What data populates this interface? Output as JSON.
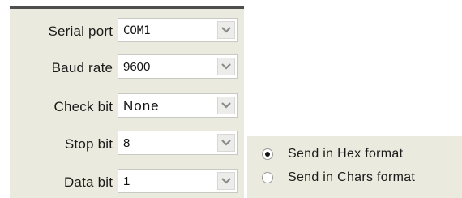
{
  "settings": {
    "rows": [
      {
        "label": "Serial port :",
        "value": "COM1"
      },
      {
        "label": "Baud rate :",
        "value": "9600"
      },
      {
        "label": "Check bit :",
        "value": "None"
      },
      {
        "label": "Stop bit :",
        "value": "8"
      },
      {
        "label": "Data bit :",
        "value": "1"
      }
    ],
    "dropdown_icon": "chevron-down-icon"
  },
  "send_format": {
    "options": [
      {
        "label": "Send in Hex format",
        "selected": true
      },
      {
        "label": "Send in Chars format",
        "selected": false
      }
    ]
  },
  "colors": {
    "panel_background": "#ebeade",
    "panel_top_border": "#4e4e4e",
    "select_background": "#ffffff",
    "chevron": "#8a8a8a"
  }
}
